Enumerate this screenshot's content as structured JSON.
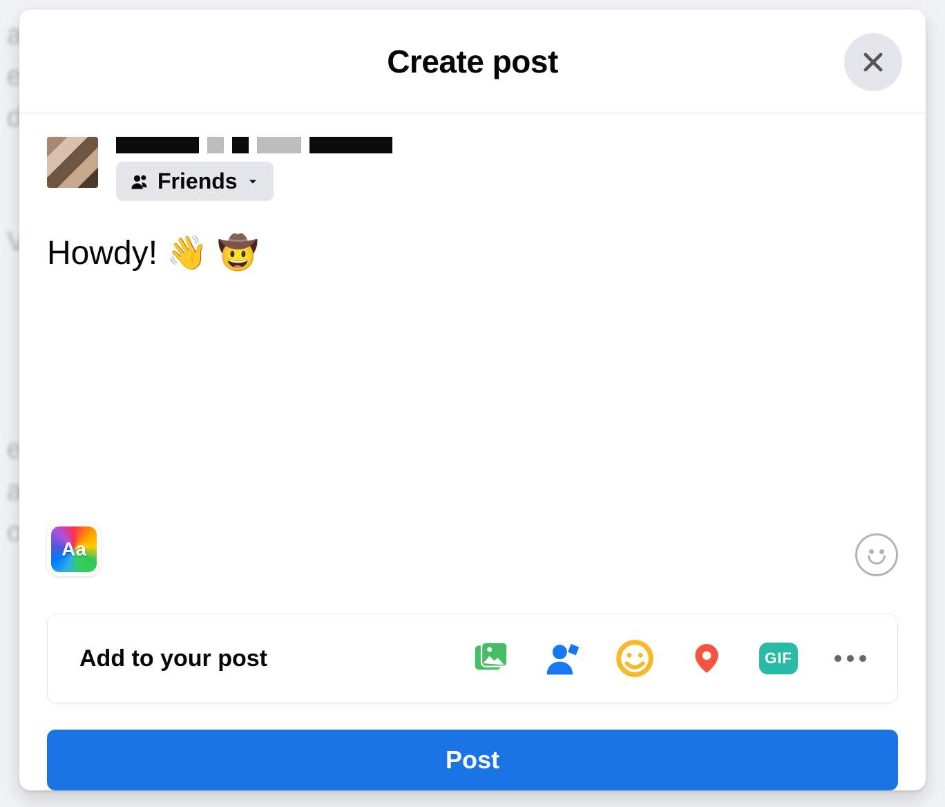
{
  "header": {
    "title": "Create post"
  },
  "author": {
    "audience_label": "Friends"
  },
  "compose": {
    "text": "Howdy! 👋 🤠"
  },
  "bg_picker": {
    "label": "Aa"
  },
  "addto": {
    "label": "Add to your post",
    "gif_label": "GIF"
  },
  "submit": {
    "label": "Post"
  }
}
